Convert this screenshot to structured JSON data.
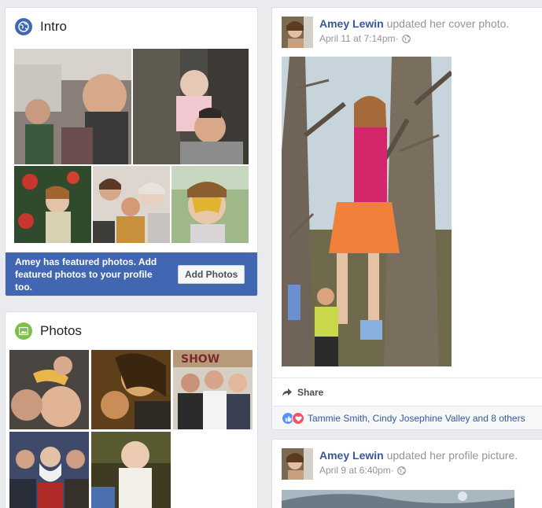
{
  "intro": {
    "title": "Intro",
    "featured_text": "Amey has featured photos. Add featured photos to your profile too.",
    "add_photos_label": "Add Photos"
  },
  "photos": {
    "title": "Photos"
  },
  "posts": [
    {
      "author": "Amey Lewin",
      "action": " updated her cover photo.",
      "timestamp": "April 11 at 7:14pm",
      "separator": " · ",
      "share_label": "Share",
      "reactions_text": "Tammie Smith, Cindy Josephine Valley and 8 others"
    },
    {
      "author": "Amey Lewin",
      "action": " updated her profile picture.",
      "timestamp": "April 9 at 6:40pm",
      "separator": " · "
    }
  ],
  "colors": {
    "brand_blue": "#4267b2",
    "link_blue": "#365899",
    "like_blue": "#5890ff",
    "love_red": "#f25268",
    "photos_green": "#7bc148"
  },
  "icons": {
    "intro": "globe-icon",
    "photos": "photo-icon",
    "privacy": "globe-icon",
    "share": "share-arrow-icon",
    "like": "like-icon",
    "love": "love-icon"
  }
}
